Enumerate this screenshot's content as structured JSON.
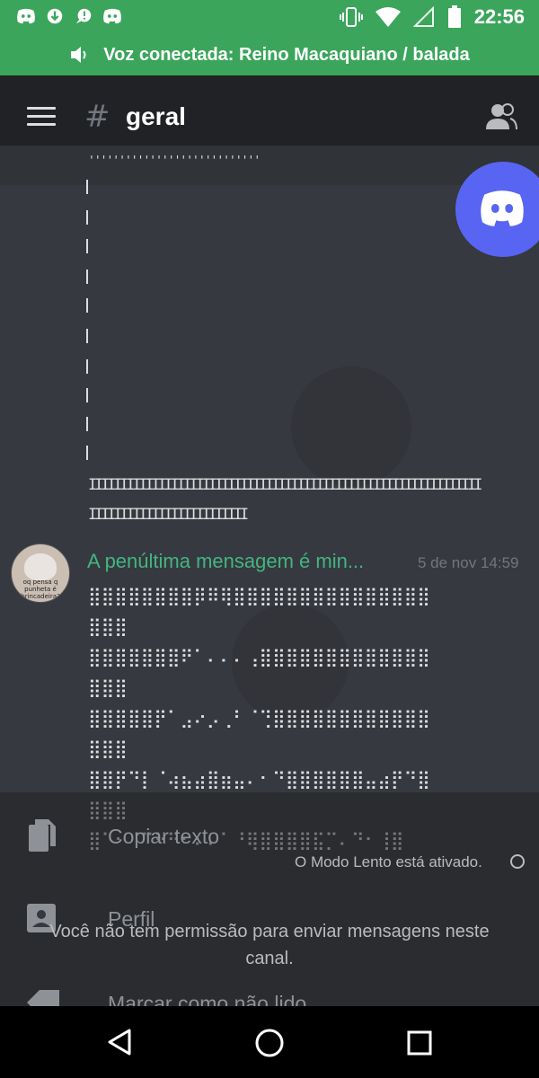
{
  "status_bar": {
    "time": "22:56",
    "notification_icons": [
      "discord-icon",
      "download-icon",
      "chat-icon",
      "discord-icon"
    ],
    "system_icons": [
      "vibrate-icon",
      "wifi-icon",
      "signal-icon",
      "battery-icon"
    ]
  },
  "voice_bar": {
    "label": "Voz conectada: Reino Macaquiano / balada",
    "icon": "speaker-icon"
  },
  "header": {
    "hash": "#",
    "channel": "geral",
    "menu_icon": "hamburger-icon",
    "members_icon": "members-icon"
  },
  "chat": {
    "ascii_art": [
      "''''''''''''''''''''''''''''",
      "|",
      "|",
      "|",
      "|",
      "|",
      "|",
      "|",
      "|",
      "|",
      "|",
      "IIIIIIIIIIIIIIIIIIIIIIIIIIIIIIIIIIIIIIIIIIIIIIIIIIIIIIIIIIIIII",
      "IIIIIIIIIIIIIIIIIIIIIIIII"
    ],
    "message": {
      "author": "A penúltima mensagem é min...",
      "timestamp": "5 de nov 14:59",
      "avatar_caption": "oq pensa q punheta é brincadeira?",
      "lines": [
        "⣿⣿⣿⣿⣿⣿⣿⣿⡿⠿⢿⣿⣿⣿⣿⣿⣿⣿⣿⣿⣿⣿⣿⣿⣿⣿",
        "⣿⣿⣿",
        "⣿⣿⣿⣿⣿⣿⣿⠟⠁⠄⠄⠄⢠⣿⣿⣿⣿⣿⣿⣿⣿⣿⣿⣿⣿⣿",
        "⣿⣿⣿",
        "⣿⣿⣿⣿⣿⡟⠁⣠⠔⡠⢀⠃⠈⢙⣿⣿⣿⣿⣿⣿⣿⣿⣿⣿⣿⣿",
        "⣿⣿⣿",
        "⣿⣿⡟⠙⡇⠈⢴⣦⣴⣿⣶⣤⠄⠂⠙⣿⣿⣿⣿⣿⣿⣤⣴⡟⠙⣿",
        "⣿⣿⣿",
        "⣿⠁⠂⠈⠉⠓⠛⠂⠆⠄⠁⠘⢿⣿⣿⣿⣿⣯⡉⠄⠙⠂⢸⣿"
      ]
    },
    "fab_icon": "discord-icon"
  },
  "context_menu": {
    "items": [
      {
        "label": "Copiar texto",
        "icon": "copy-icon"
      },
      {
        "label": "Perfil",
        "icon": "profile-icon"
      },
      {
        "label": "Marcar como não lido",
        "icon": "unread-icon"
      }
    ]
  },
  "composer": {
    "slowmode": "O Modo Lento está ativado.",
    "no_permission": "Você não tem permissão para enviar mensagens neste canal."
  },
  "nav_bar": {
    "back_icon": "back-icon",
    "home_icon": "home-icon",
    "recents_icon": "recents-icon"
  }
}
